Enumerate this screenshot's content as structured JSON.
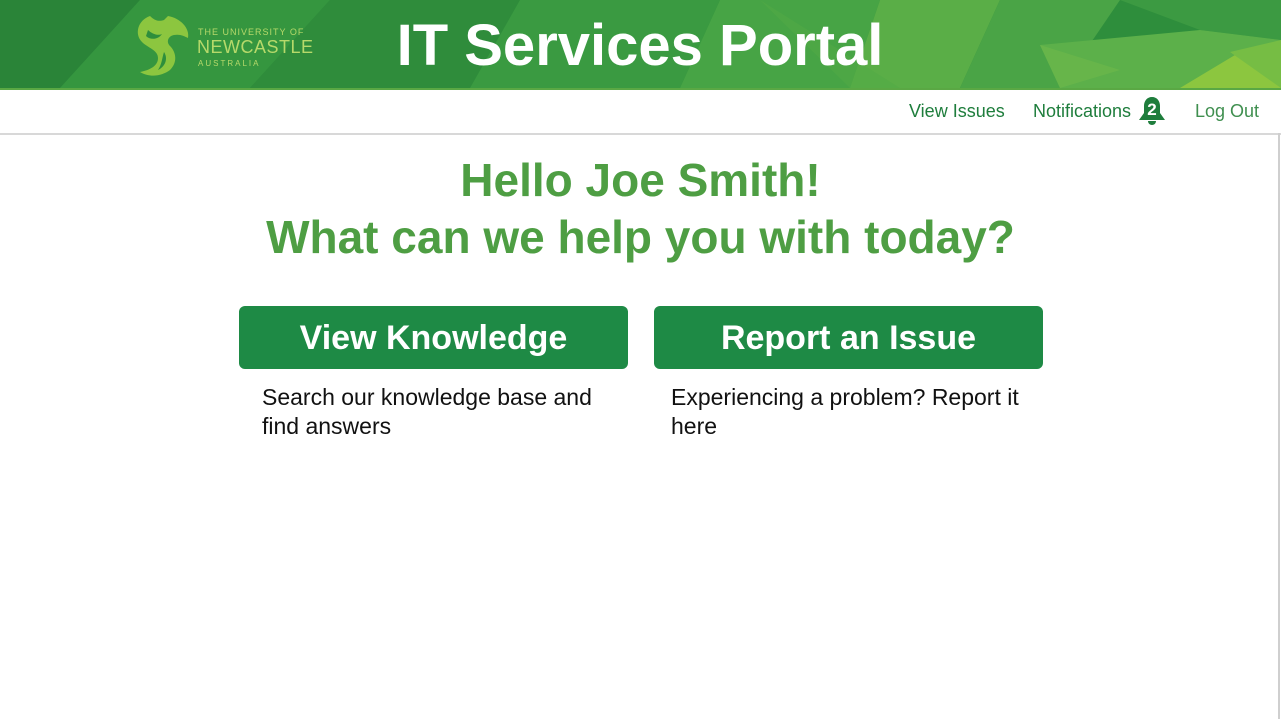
{
  "header": {
    "title": "IT Services Portal",
    "logo": {
      "line1": "THE UNIVERSITY OF",
      "line2": "NEWCASTLE",
      "line3": "AUSTRALIA",
      "icon": "seahorse-icon"
    }
  },
  "nav": {
    "view_issues": "View Issues",
    "notifications": "Notifications",
    "notification_count": "2",
    "notification_icon": "bell-icon",
    "log_out": "Log Out"
  },
  "greeting": {
    "line1": "Hello Joe Smith!",
    "line2": "What can we help you with today?"
  },
  "actions": [
    {
      "label": "View Knowledge",
      "description": "Search our knowledge base and find answers"
    },
    {
      "label": "Report an Issue",
      "description": "Experiencing a problem? Report it here"
    }
  ],
  "colors": {
    "brand_green": "#1e8a45",
    "greeting_green": "#4e9e43",
    "logo_lime": "#b6d96a",
    "nav_link": "#1e7d3c"
  }
}
